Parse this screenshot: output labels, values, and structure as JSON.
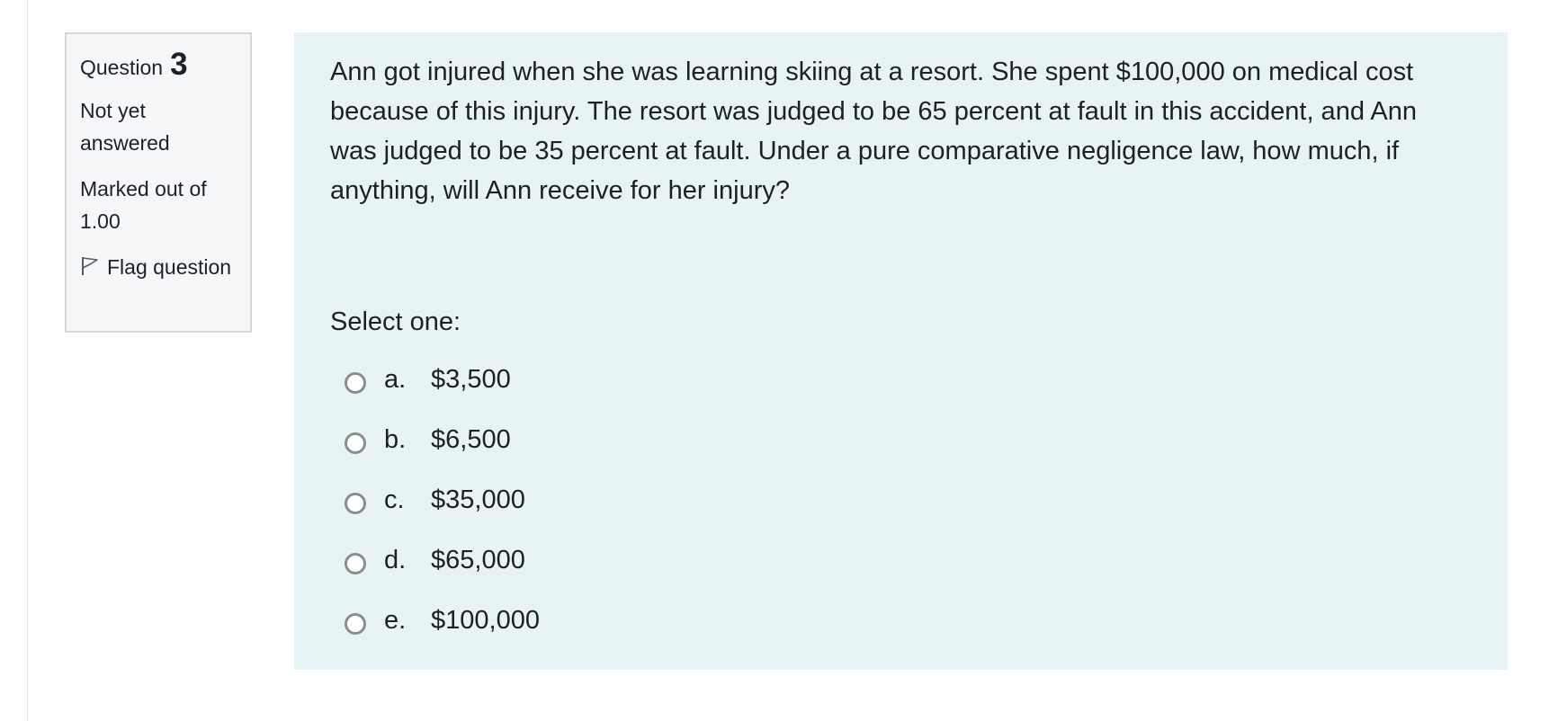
{
  "question_info": {
    "label": "Question",
    "number": "3",
    "state": "Not yet answered",
    "grade": "Marked out of 1.00",
    "flag_label": "Flag question"
  },
  "question": {
    "text": "Ann got injured when she was learning skiing at a resort. She spent $100,000 on medical cost because of this injury. The resort was judged to be 65 percent at fault in this accident, and Ann was judged to be 35 percent at fault. Under a pure comparative negligence law, how much, if anything, will Ann receive for her injury?",
    "prompt": "Select one:",
    "options": [
      {
        "letter": "a.",
        "value": "$3,500"
      },
      {
        "letter": "b.",
        "value": "$6,500"
      },
      {
        "letter": "c.",
        "value": "$35,000"
      },
      {
        "letter": "d.",
        "value": "$65,000"
      },
      {
        "letter": "e.",
        "value": "$100,000"
      }
    ]
  },
  "colors": {
    "info_background": "#f5f7f9",
    "content_background": "#e7f3f5",
    "text": "#1d2125"
  },
  "icons": {
    "flag": "flag-icon"
  }
}
